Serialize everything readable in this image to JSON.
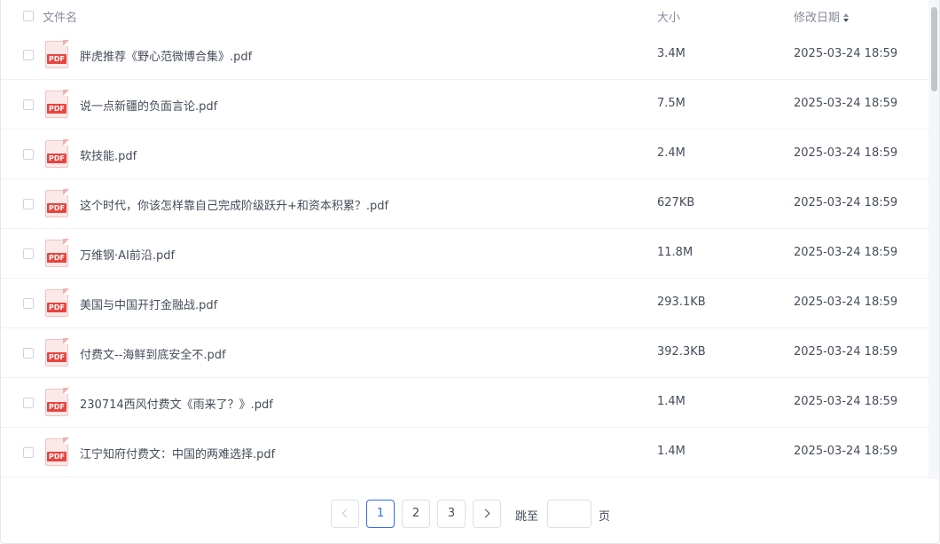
{
  "table": {
    "columns": {
      "name": "文件名",
      "size": "大小",
      "date": "修改日期"
    },
    "rows": [
      {
        "name": "胖虎推荐《野心范微博合集》.pdf",
        "size": "3.4M",
        "date": "2025-03-24 18:59",
        "type_label": "PDF"
      },
      {
        "name": "说一点新疆的负面言论.pdf",
        "size": "7.5M",
        "date": "2025-03-24 18:59",
        "type_label": "PDF"
      },
      {
        "name": "软技能.pdf",
        "size": "2.4M",
        "date": "2025-03-24 18:59",
        "type_label": "PDF"
      },
      {
        "name": "这个时代，你该怎样靠自己完成阶级跃升+和资本积累？.pdf",
        "size": "627KB",
        "date": "2025-03-24 18:59",
        "type_label": "PDF"
      },
      {
        "name": "万维钢·AI前沿.pdf",
        "size": "11.8M",
        "date": "2025-03-24 18:59",
        "type_label": "PDF"
      },
      {
        "name": "美国与中国开打金融战.pdf",
        "size": "293.1KB",
        "date": "2025-03-24 18:59",
        "type_label": "PDF"
      },
      {
        "name": "付费文--海鲜到底安全不.pdf",
        "size": "392.3KB",
        "date": "2025-03-24 18:59",
        "type_label": "PDF"
      },
      {
        "name": "230714西风付费文《雨来了？》.pdf",
        "size": "1.4M",
        "date": "2025-03-24 18:59",
        "type_label": "PDF"
      },
      {
        "name": "江宁知府付费文：中国的两难选择.pdf",
        "size": "1.4M",
        "date": "2025-03-24 18:59",
        "type_label": "PDF"
      }
    ]
  },
  "pagination": {
    "pages": [
      "1",
      "2",
      "3"
    ],
    "current": "1",
    "jump_label": "跳至",
    "page_suffix": "页",
    "jump_value": ""
  },
  "colors": {
    "accent": "#2f6fe0",
    "pdf_red": "#e8443f"
  },
  "icons": {
    "file": "pdf-file-icon",
    "prev": "chevron-left-icon",
    "next": "chevron-right-icon",
    "sort": "sort-icon"
  }
}
